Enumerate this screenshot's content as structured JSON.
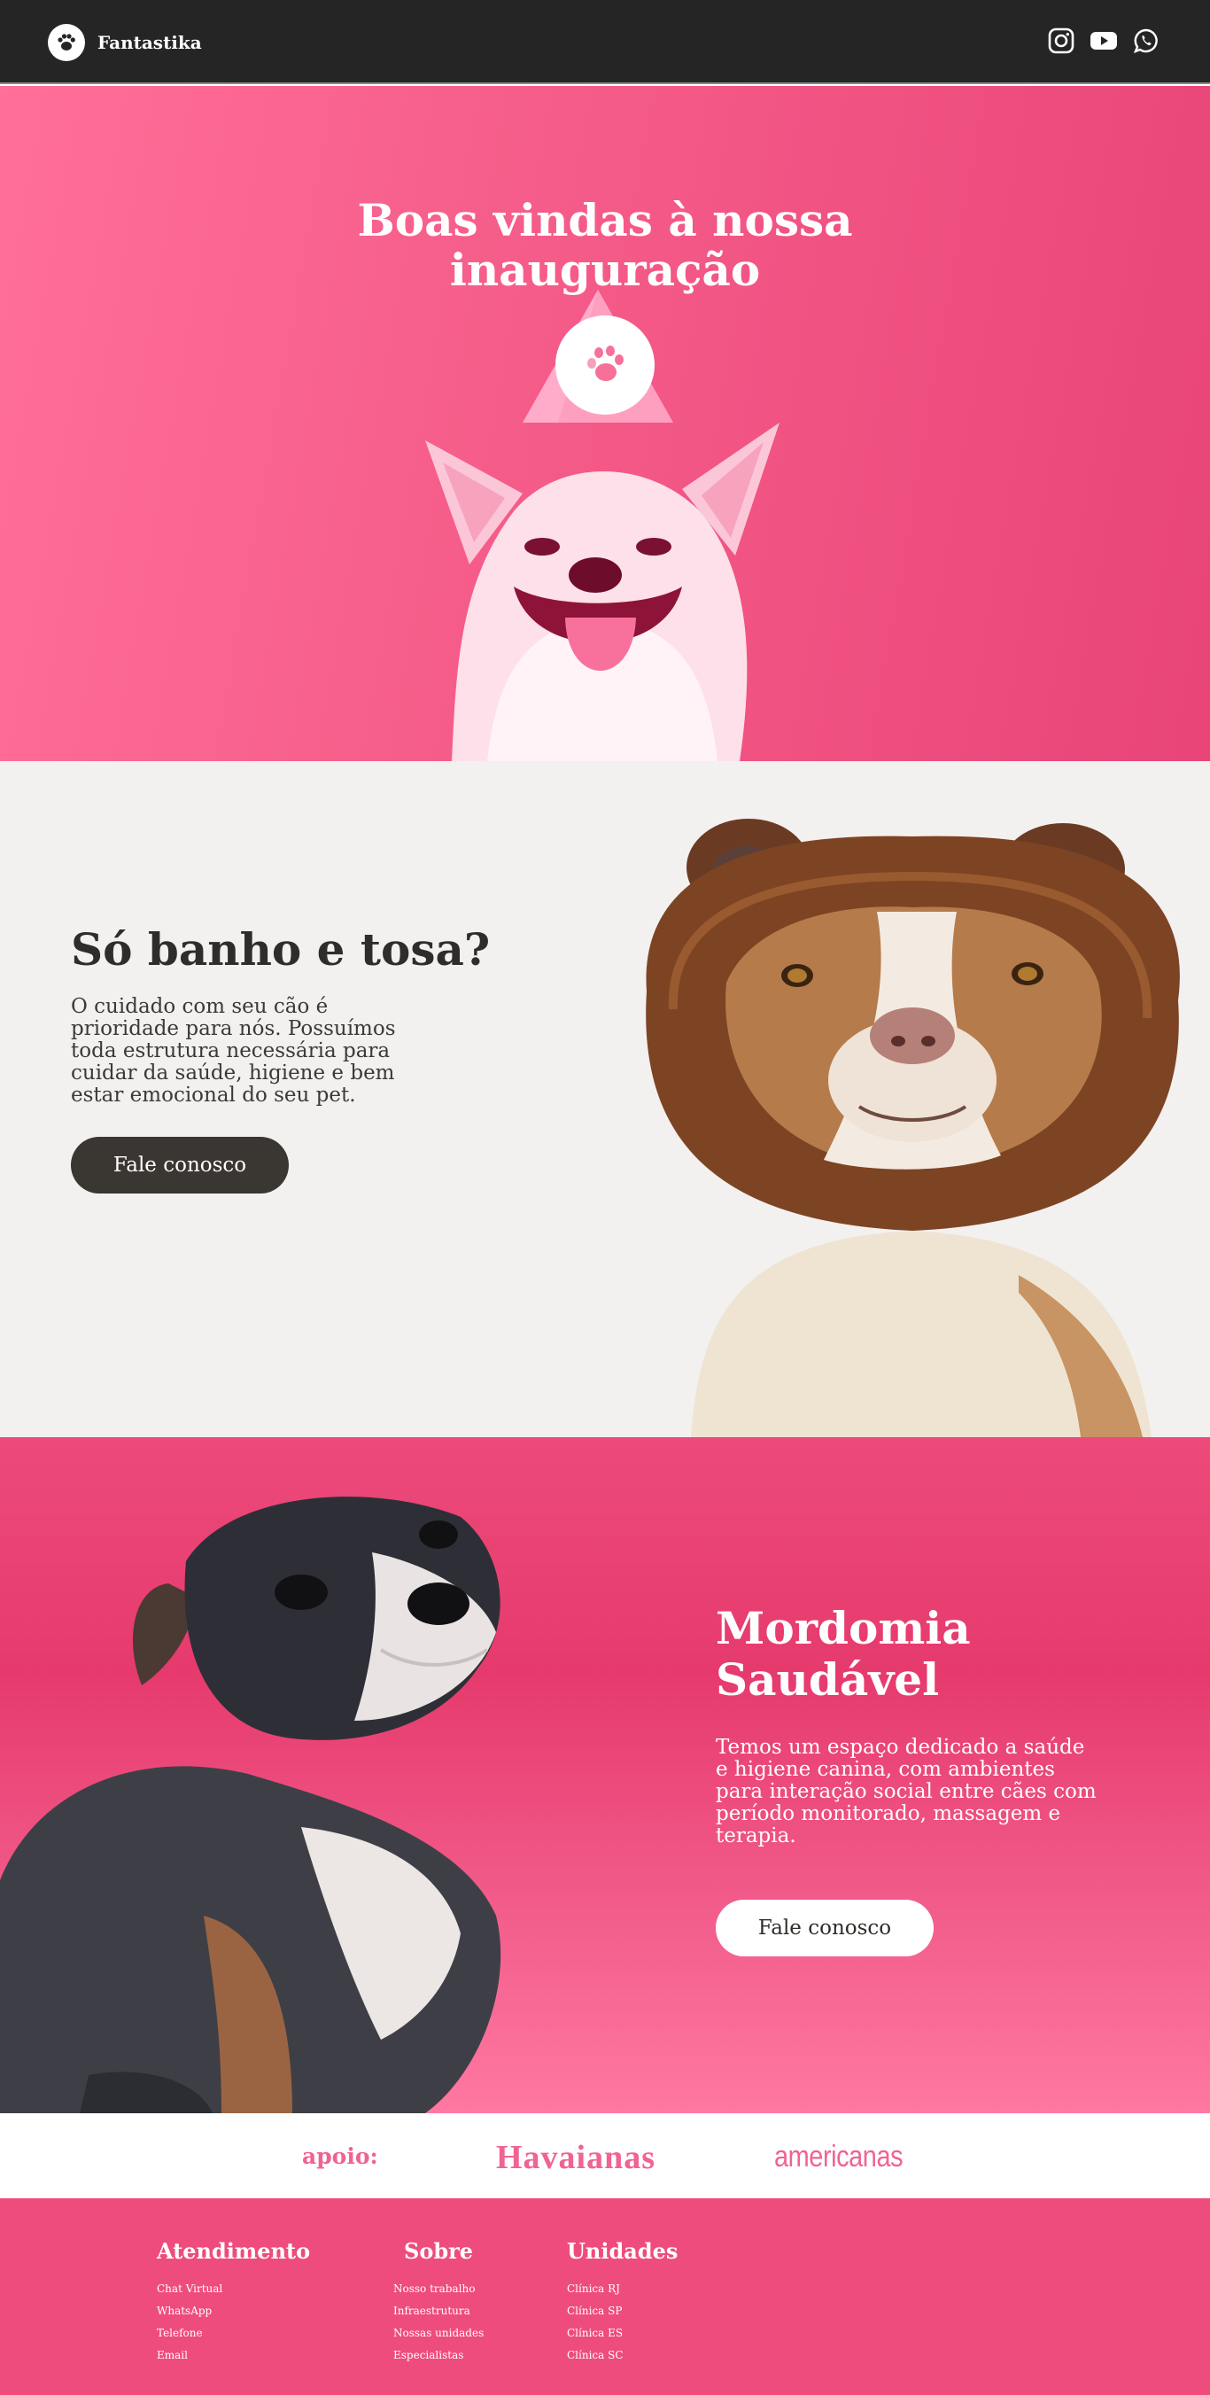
{
  "header": {
    "brand_name": "Fantastika",
    "logo_icon": "paw-icon",
    "social": [
      "instagram-icon",
      "youtube-icon",
      "whatsapp-icon"
    ]
  },
  "hero": {
    "title_line1": "Boas vindas à nossa",
    "title_line2": "inauguração",
    "badge_icon": "paw-icon"
  },
  "section_care": {
    "title": "Só banho e tosa?",
    "text": "O cuidado com seu cão é prioridade para nós. Possuímos toda estrutura necessária para cuidar da saúde, higiene e bem estar emocional do seu pet.",
    "button_label": "Fale conosco"
  },
  "section_spa": {
    "title": "Mordomia Saudável",
    "text": "Temos um espaço dedicado a saúde e higiene canina, com ambientes para interação social entre cães com período monitorado, massagem e terapia.",
    "button_label": "Fale conosco"
  },
  "sponsors": {
    "label": "apoio:",
    "brands": [
      "Havaianas",
      "americanas"
    ]
  },
  "footer": {
    "columns": [
      {
        "title": "Atendimento",
        "items": [
          "Chat Virtual",
          "WhatsApp",
          "Telefone",
          "Email"
        ]
      },
      {
        "title": "Sobre",
        "items": [
          "Nosso trabalho",
          "Infraestrutura",
          "Nossas unidades",
          "Especialistas"
        ]
      },
      {
        "title": "Unidades",
        "items": [
          "Clínica RJ",
          "Clínica SP",
          "Clínica ES",
          "Clínica SC"
        ]
      }
    ]
  },
  "colors": {
    "header_bg": "#252525",
    "pink": "#ee4c7c",
    "grey_bg": "#f3f0f0",
    "dark_button": "#3a3631"
  }
}
